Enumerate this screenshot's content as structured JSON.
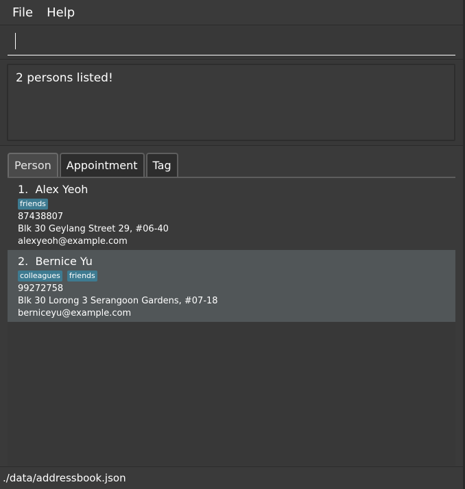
{
  "menu": {
    "file": "File",
    "help": "Help"
  },
  "command": {
    "value": "",
    "placeholder": ""
  },
  "result": {
    "text": "2 persons listed!"
  },
  "tabs": [
    {
      "label": "Person",
      "selected": true
    },
    {
      "label": "Appointment",
      "selected": false
    },
    {
      "label": "Tag",
      "selected": false
    }
  ],
  "persons": [
    {
      "index": "1.",
      "name": "Alex Yeoh",
      "tags": [
        "friends"
      ],
      "phone": "87438807",
      "address": "Blk 30 Geylang Street 29, #06-40",
      "email": "alexyeoh@example.com"
    },
    {
      "index": "2.",
      "name": "Bernice Yu",
      "tags": [
        "colleagues",
        "friends"
      ],
      "phone": "99272758",
      "address": "Blk 30 Lorong 3 Serangoon Gardens, #07-18",
      "email": "berniceyu@example.com"
    }
  ],
  "status": {
    "path": "./data/addressbook.json"
  },
  "colors": {
    "background": "#3a3a3a",
    "tag": "#3e7b91",
    "selected_row": "#515658"
  }
}
